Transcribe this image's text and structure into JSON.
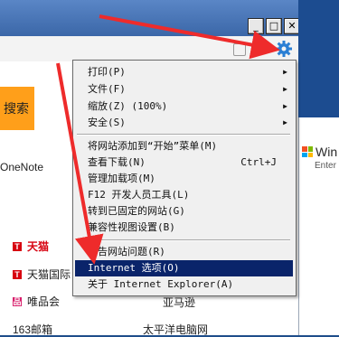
{
  "window": {
    "controls": {
      "minimize": "_",
      "maximize": "□",
      "close": "✕"
    }
  },
  "page": {
    "orange_button_label": "搜索",
    "onenote_label": "OneNote",
    "sites_left": [
      {
        "icon": "T",
        "label": "天猫"
      },
      {
        "icon": "T",
        "label": "天猫国际"
      },
      {
        "icon": "品",
        "label": "唯品会"
      },
      {
        "icon": "",
        "label": "163邮箱"
      }
    ],
    "sites_right": [
      {
        "label": "亚马逊"
      },
      {
        "label": "太平洋电脑网"
      }
    ]
  },
  "bg_window": {
    "logo_text": "Win",
    "logo_sub": "Enter"
  },
  "menu": {
    "group1": [
      {
        "label": "打印(P)",
        "submenu": true
      },
      {
        "label": "文件(F)",
        "submenu": true
      },
      {
        "label": "缩放(Z) (100%)",
        "submenu": true
      },
      {
        "label": "安全(S)",
        "submenu": true
      }
    ],
    "group2": [
      {
        "label": "将网站添加到“开始”菜单(M)",
        "shortcut": ""
      },
      {
        "label": "查看下载(N)",
        "shortcut": "Ctrl+J"
      },
      {
        "label": "管理加载项(M)",
        "shortcut": ""
      },
      {
        "label": "F12 开发人员工具(L)",
        "shortcut": ""
      },
      {
        "label": "转到已固定的网站(G)",
        "shortcut": ""
      },
      {
        "label": "兼容性视图设置(B)",
        "shortcut": ""
      }
    ],
    "group3": [
      {
        "label": "报告网站问题(R)",
        "selected": false
      },
      {
        "label": "Internet 选项(O)",
        "selected": true
      },
      {
        "label": "关于 Internet Explorer(A)",
        "selected": false
      }
    ]
  },
  "colors": {
    "arrow": "#ee2b2b",
    "selection": "#0a246a",
    "gear": "#2a7fd4"
  }
}
